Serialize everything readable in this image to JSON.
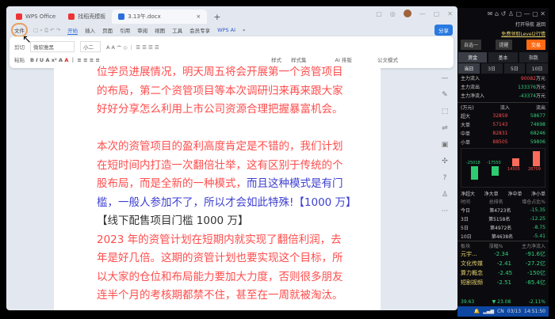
{
  "tabs": [
    {
      "label": "WPS Office",
      "icon": "wps-logo-icon",
      "color": "#e33"
    },
    {
      "label": "找稻壳模板",
      "icon": "docer-icon",
      "color": "#e33"
    },
    {
      "label": "3.13午.docx",
      "icon": "word-doc-icon",
      "color": "#2a6fdb"
    }
  ],
  "menu": {
    "file": "文件",
    "items": [
      "开始",
      "插入",
      "页面",
      "引用",
      "审阅",
      "视图",
      "工具",
      "会员专享"
    ],
    "ai": "WPS AI",
    "share": "分享"
  },
  "ribbon": {
    "cut": "剪切",
    "paste": "粘贴",
    "font": "微软雅黑",
    "size": "小二",
    "style": "样式",
    "style_set": "样式集",
    "ai_layout": "AI 排版",
    "doc_format": "公文模式"
  },
  "document": [
    {
      "text": "位学员进展情况，明天周五将会开展第一个资管项目",
      "color": "red"
    },
    {
      "text": "的布局，第二个资管项目等本次调研归来再来跟大家",
      "color": "red"
    },
    {
      "text": "好好分享怎么利用上市公司资源合理把握暴富机会。",
      "color": "red"
    },
    {
      "text": "",
      "color": "red"
    },
    {
      "text": "本次的资管项目的盈利高度肯定是不错的，我们计划",
      "color": "red"
    },
    {
      "text": "在短时间内打造一次翻倍壮举，这有区别于传统的个",
      "color": "red"
    },
    {
      "text": "股布局，而是全新的一种模式，",
      "color": "red",
      "tail": "而且这种模式是有门"
    },
    {
      "text": "",
      "color": "blue",
      "tail": "槛，一般人参加不了，所以才会如此特殊!【1000 万】"
    },
    {
      "text": "【线下配售项目门槛 1000 万】",
      "color": "dark"
    },
    {
      "text": "2023 年的资管计划在短期内就实现了翻倍利润，去",
      "color": "red"
    },
    {
      "text": "年是好几倍。这期的资管计划也要实现这个目标，所",
      "color": "red"
    },
    {
      "text": "以大家的仓位和布局能力要加大力度，否则很多朋友",
      "color": "red"
    },
    {
      "text": "连半个月的考核期都禁不住，甚至在一周就被淘汰。",
      "color": "red"
    }
  ],
  "stock": {
    "nav": "打开导航",
    "back": "返回",
    "promo": "免费领取Level2行情",
    "watch": "自选一",
    "alert": "提醒",
    "trade": "交易",
    "tabs": [
      "资金",
      "基本",
      "指数"
    ],
    "periods": [
      "当日",
      "3日",
      "5日",
      "10日"
    ],
    "flows": [
      {
        "label": "主力流入",
        "value": "90082",
        "unit": "万元",
        "color": "red"
      },
      {
        "label": "主力流出",
        "value": "133376",
        "unit": "万元",
        "color": "grn"
      },
      {
        "label": "主力净流入",
        "value": "-43374",
        "unit": "万元",
        "color": "grn"
      }
    ],
    "table_header": [
      "(万元)",
      "流入",
      "流出"
    ],
    "table": [
      [
        "超大",
        "32859",
        "58677"
      ],
      [
        "大单",
        "57143",
        "74698"
      ],
      [
        "中单",
        "82831",
        "68246"
      ],
      [
        "小单",
        "88505",
        "59806"
      ]
    ],
    "chart": {
      "values": [
        -25018,
        -17550,
        14505,
        28709
      ],
      "labels": [
        "-25018",
        "-17550",
        "14505",
        "28709"
      ],
      "categories": [
        "净超大",
        "净大单",
        "净中单",
        "净小单"
      ]
    },
    "rank_header": [
      "时间",
      "总排名",
      "增仓占比%"
    ],
    "rank": [
      [
        "今日",
        "第4723名",
        "-15.35"
      ],
      [
        "3日",
        "第5158名",
        "-12.25"
      ],
      [
        "5日",
        "第4972名",
        "-8.75"
      ],
      [
        "10日",
        "第4638名",
        "-5.41"
      ]
    ],
    "sector_header": [
      "板块",
      "涨幅%",
      "主力净流入"
    ],
    "sectors": [
      [
        "元宇...",
        "-2.34",
        "-91.6亿"
      ],
      [
        "文化传媒",
        "-2.41",
        "-27.2亿"
      ],
      [
        "算力概念",
        "-2.45",
        "-150亿"
      ],
      [
        "短剧视频",
        "-2.51",
        "-85.4亿"
      ]
    ],
    "ticker": {
      "price": "39.63",
      "change": "▼ 23.08",
      "pct": "-2.11%"
    },
    "status": {
      "lang": "CN",
      "date": "03/13",
      "time": "14:51:50"
    }
  }
}
